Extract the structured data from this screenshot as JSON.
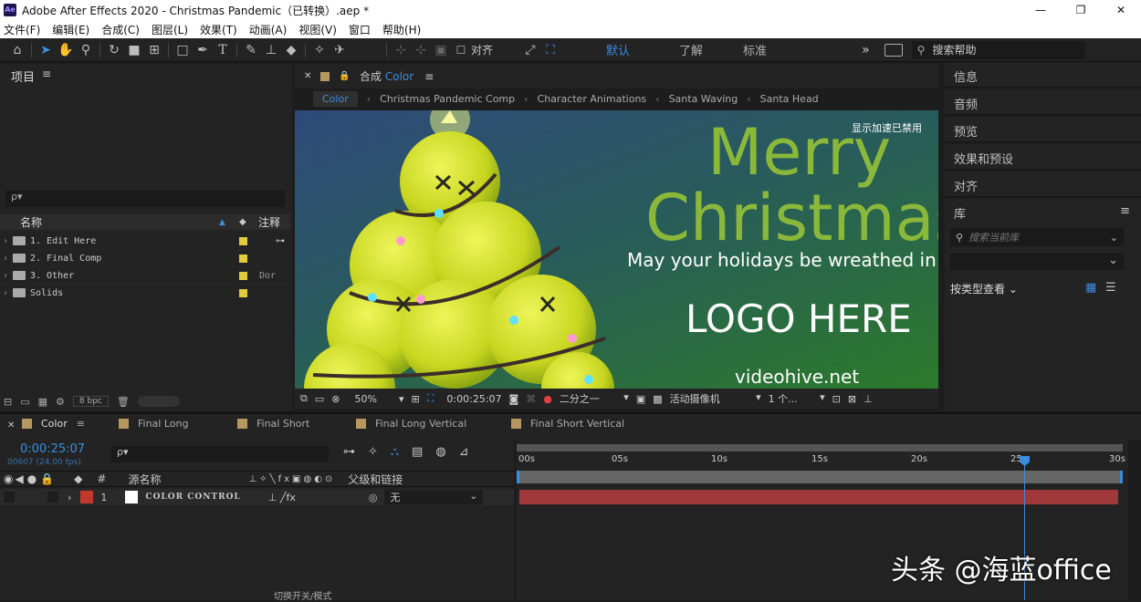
{
  "title": {
    "app_icon": "Ae",
    "text": "Adobe After Effects 2020 - Christmas Pandemic（已转换）.aep *",
    "minimize": "—",
    "maximize": "❐",
    "close": "✕"
  },
  "menu": [
    "文件(F)",
    "编辑(E)",
    "合成(C)",
    "图层(L)",
    "效果(T)",
    "动画(A)",
    "视图(V)",
    "窗口",
    "帮助(H)"
  ],
  "toolbar": {
    "align_label": "对齐",
    "workspaces": [
      "默认",
      "了解",
      "标准"
    ],
    "more": "»",
    "search_placeholder": "搜索帮助"
  },
  "project": {
    "title": "项目",
    "search_placeholder": "ρ▾",
    "col_name": "名称",
    "col_comment": "注释",
    "items": [
      {
        "label": "1. Edit Here",
        "comment": ""
      },
      {
        "label": "2. Final Comp",
        "comment": ""
      },
      {
        "label": "3. Other",
        "comment": "Dor"
      },
      {
        "label": "Solids",
        "comment": ""
      }
    ],
    "bpc": "8 bpc"
  },
  "comp": {
    "tab_prefix": "合成",
    "tab_name": "Color",
    "breadcrumbs": [
      "Color",
      "Christmas Pandemic Comp",
      "Character Animations",
      "Santa Waving",
      "Santa Head"
    ],
    "gpu_notice": "显示加速已禁用",
    "viewer_text": {
      "merry": "Merry",
      "christmas": "Christmas",
      "tagline": "May your holidays be wreathed in",
      "logo": "LOGO HERE",
      "site": "videohive.net"
    },
    "footer": {
      "zoom": "50%",
      "timecode": "0:00:25:07",
      "resolution": "二分之一",
      "camera": "活动摄像机",
      "views": "1 个..."
    }
  },
  "right_panels": [
    "信息",
    "音频",
    "预览",
    "效果和预设",
    "对齐",
    "库"
  ],
  "library": {
    "search_placeholder": "搜索当前库",
    "view_label": "按类型查看"
  },
  "timeline": {
    "tabs": [
      {
        "name": "Color",
        "color": "#b5975f"
      },
      {
        "name": "Final Long",
        "color": "#b5975f"
      },
      {
        "name": "Final Short",
        "color": "#b5975f"
      },
      {
        "name": "Final Long Vertical",
        "color": "#b5975f"
      },
      {
        "name": "Final Short Vertical",
        "color": "#b5975f"
      }
    ],
    "timecode": "0:00:25:07",
    "frames": "00607 (24.00 fps)",
    "search_placeholder": "ρ▾",
    "col_num": "#",
    "col_source": "源名称",
    "col_parent": "父级和链接",
    "ruler": [
      "00s",
      "05s",
      "10s",
      "15s",
      "20s",
      "25s",
      "30s"
    ],
    "layer": {
      "num": "1",
      "name": "COLOR CONTROL",
      "parent": "无",
      "label_color": "#c0392b",
      "bar_color": "#a0393c"
    },
    "playhead_fraction": 0.842,
    "footer_label": "切换开关/模式"
  },
  "watermark": "头条 @海蓝office",
  "colors": {
    "accent": "#3a8de0",
    "merry": "#8ab83a",
    "tree": "#d6e62a"
  }
}
